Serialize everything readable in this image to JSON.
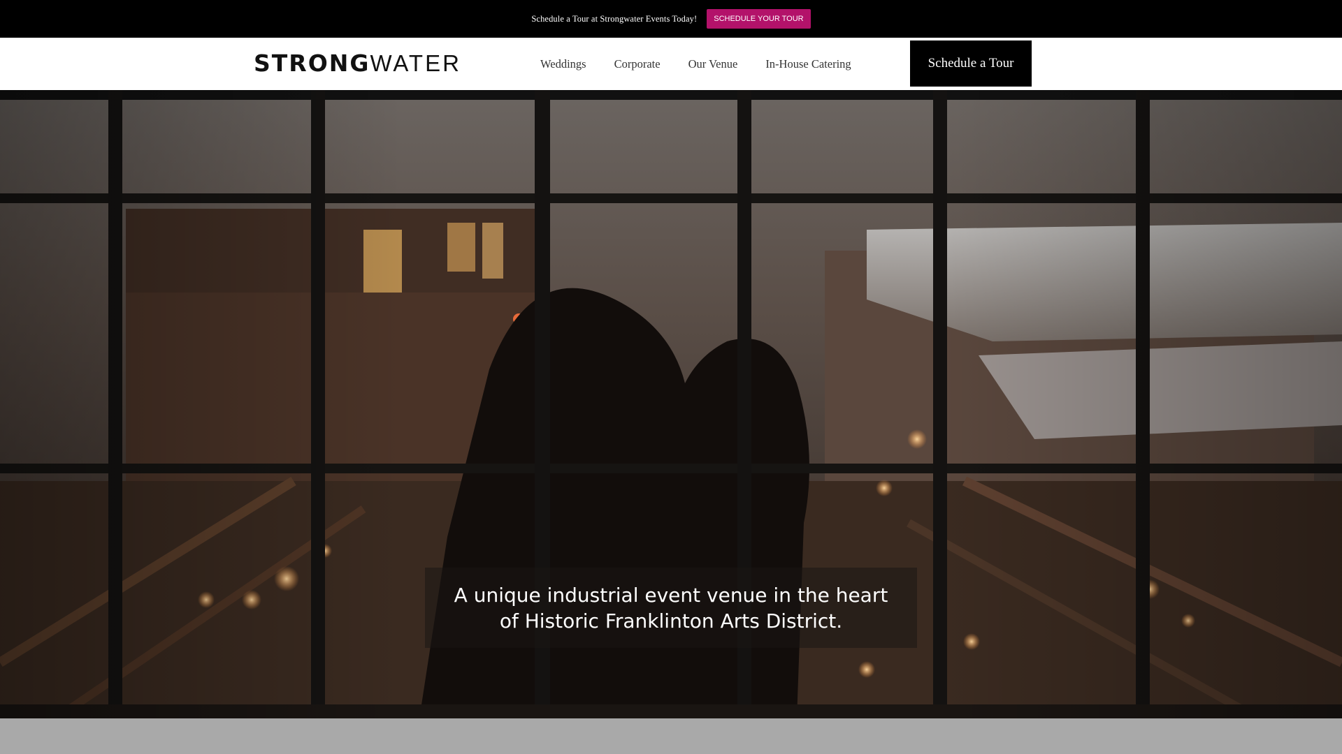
{
  "announcement": {
    "text": "Schedule a Tour at Strongwater Events Today!",
    "button_label": "SCHEDULE YOUR TOUR",
    "button_color": "#b3126a"
  },
  "header": {
    "logo_strong": "STRONG",
    "logo_water": "WATER",
    "nav": [
      {
        "label": "Weddings"
      },
      {
        "label": "Corporate"
      },
      {
        "label": "Our Venue"
      },
      {
        "label": "In-House Catering"
      }
    ],
    "cta_label": "Schedule a Tour"
  },
  "hero": {
    "tagline": "A unique industrial event venue in the heart of Historic Franklinton Arts District."
  }
}
